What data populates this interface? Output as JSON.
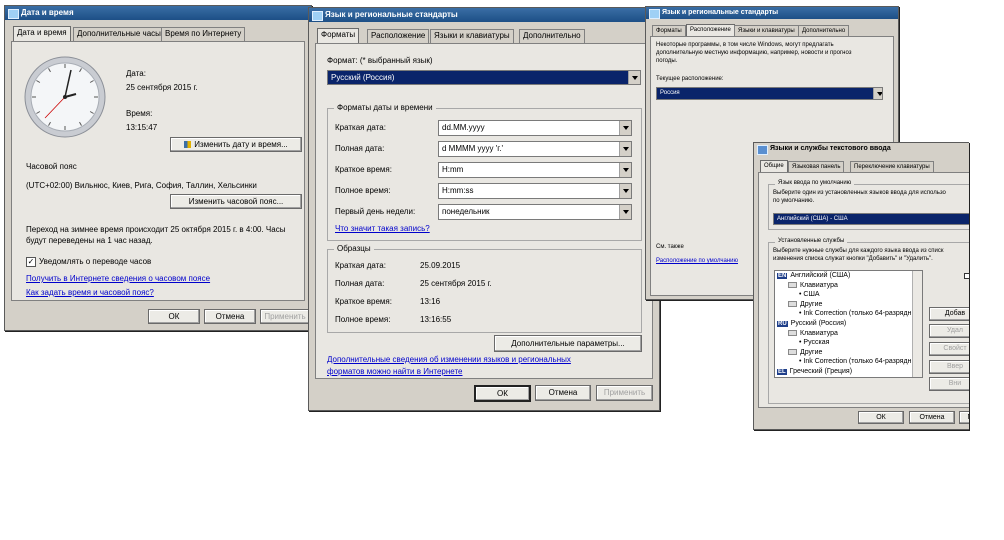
{
  "dt": {
    "title": "Дата и время",
    "tabs": [
      "Дата и время",
      "Дополнительные часы",
      "Время по Интернету"
    ],
    "date_label": "Дата:",
    "date_value": "25 сентября 2015 г.",
    "time_label": "Время:",
    "time_value": "13:15:47",
    "change_datetime": "Изменить дату и время...",
    "tz_label": "Часовой пояс",
    "tz_value": "(UTC+02:00) Вильнюс, Киев, Рига, София, Таллин, Хельсинки",
    "change_tz": "Изменить часовой пояс...",
    "dst_line1": "Переход на зимнее время происходит 25 октября 2015 г. в 4:00. Часы",
    "dst_line2": "будут переведены на 1 час назад.",
    "notify_label": "Уведомлять о переводе часов",
    "link1": "Получить в Интернете сведения о часовом поясе",
    "link2": "Как задать время и часовой пояс?",
    "ok": "ОК",
    "cancel": "Отмена",
    "apply": "Применить"
  },
  "lr": {
    "title": "Язык и региональные стандарты",
    "tabs": [
      "Форматы",
      "Расположение",
      "Языки и клавиатуры",
      "Дополнительно"
    ],
    "format_label": "Формат: (* выбранный язык)",
    "format_value": "Русский (Россия)",
    "group_formats": "Форматы даты и времени",
    "rows": [
      {
        "label": "Краткая дата:",
        "value": "dd.MM.yyyy"
      },
      {
        "label": "Полная дата:",
        "value": "d MMMM yyyy 'г.'"
      },
      {
        "label": "Краткое время:",
        "value": "H:mm"
      },
      {
        "label": "Полное время:",
        "value": "H:mm:ss"
      },
      {
        "label": "Первый день недели:",
        "value": "понедельник"
      }
    ],
    "notation_link": "Что значит такая запись?",
    "group_samples": "Образцы",
    "samples": [
      {
        "label": "Краткая дата:",
        "value": "25.09.2015"
      },
      {
        "label": "Полная дата:",
        "value": "25 сентября 2015 г."
      },
      {
        "label": "Краткое время:",
        "value": "13:16"
      },
      {
        "label": "Полное время:",
        "value": "13:16:55"
      }
    ],
    "advanced": "Дополнительные параметры...",
    "more_line1": "Дополнительные сведения об изменении языков и региональных",
    "more_line2": "форматов можно найти в Интернете",
    "ok": "ОК",
    "cancel": "Отмена",
    "apply": "Применить"
  },
  "loc": {
    "title": "Язык и региональные стандарты",
    "tabs": [
      "Форматы",
      "Расположение",
      "Языки и клавиатуры",
      "Дополнительно"
    ],
    "desc_line1": "Некоторые программы, в том числе Windows, могут предлагать",
    "desc_line2": "дополнительную местную информацию, например, новости и прогноз",
    "desc_line3": "погоды.",
    "current_label": "Текущее расположение:",
    "current_value": "Россия",
    "see_also": "См. также",
    "default_link": "Расположение по умолчанию"
  },
  "ts": {
    "title": "Языки и службы текстового ввода",
    "tabs": [
      "Общие",
      "Языковая панель",
      "Переключение клавиатуры"
    ],
    "default_group": "Язык ввода по умолчанию",
    "default_desc1": "Выберите один из установленных языков ввода для использо",
    "default_desc2": "по умолчанию.",
    "default_value": "Английский (США) - США",
    "installed_group": "Установленные службы",
    "installed_desc1": "Выберите нужные службы для каждого языка ввода из списк",
    "installed_desc2": "изменения списка служат кнопки \"Добавить\" и \"Удалить\".",
    "tree": [
      {
        "badge": "EN",
        "text": "Английский (США)",
        "level": 0
      },
      {
        "text": "Клавиатура",
        "level": 1
      },
      {
        "text": "США",
        "level": 2
      },
      {
        "text": "Другие",
        "level": 1
      },
      {
        "text": "Ink Correction (только 64-разрядн",
        "level": 2
      },
      {
        "badge": "RU",
        "text": "Русский (Россия)",
        "level": 0
      },
      {
        "text": "Клавиатура",
        "level": 1
      },
      {
        "text": "Русская",
        "level": 2
      },
      {
        "text": "Другие",
        "level": 1
      },
      {
        "text": "Ink Correction (только 64-разрядн",
        "level": 2
      },
      {
        "badge": "EL",
        "text": "Греческий (Греция)",
        "level": 0
      }
    ],
    "side_buttons": [
      "Добав",
      "Удал",
      "Свойст",
      "Ввер",
      "Вни"
    ],
    "ok": "ОК",
    "cancel": "Отмена",
    "apply": "П"
  }
}
